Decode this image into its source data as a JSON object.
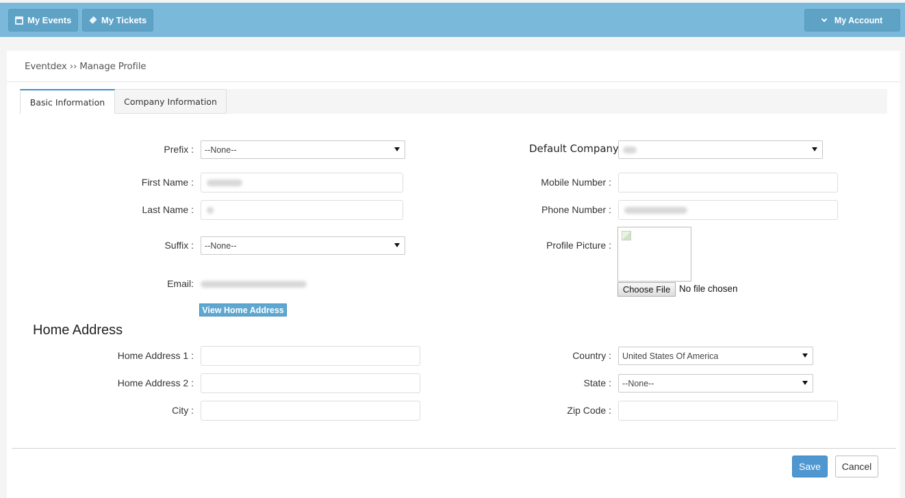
{
  "topbar": {
    "my_events": "My Events",
    "my_tickets": "My Tickets",
    "my_account": "My Account"
  },
  "breadcrumb": "Eventdex ›› Manage Profile",
  "tabs": [
    {
      "label": "Basic Information",
      "active": true
    },
    {
      "label": "Company Information",
      "active": false
    }
  ],
  "basic": {
    "prefix_label": "Prefix :",
    "prefix_value": "--None--",
    "first_name_label": "First Name :",
    "last_name_label": "Last Name :",
    "suffix_label": "Suffix :",
    "suffix_value": "--None--",
    "email_label": "Email:",
    "view_home_address": "View Home Address"
  },
  "contact": {
    "default_company_label": "Default Company:",
    "mobile_label": "Mobile Number :",
    "phone_label": "Phone Number :",
    "profile_picture_label": "Profile Picture :",
    "choose_file": "Choose File",
    "no_file": "No file chosen"
  },
  "home_address": {
    "title": "Home Address",
    "address1_label": "Home Address 1 :",
    "address2_label": "Home Address 2 :",
    "city_label": "City :",
    "country_label": "Country :",
    "country_value": "United States Of America",
    "state_label": "State :",
    "state_value": "--None--",
    "zip_label": "Zip Code :"
  },
  "actions": {
    "save": "Save",
    "cancel": "Cancel"
  },
  "colors": {
    "topbar": "#7ab9d9",
    "accent": "#4e97d1"
  }
}
